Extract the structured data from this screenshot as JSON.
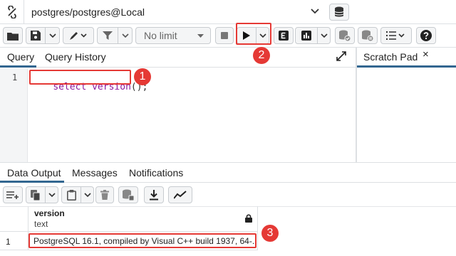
{
  "connection": {
    "label": "postgres/postgres@Local"
  },
  "toolbar": {
    "limit_label": "No limit"
  },
  "query_tabs": {
    "query": "Query",
    "history": "Query History",
    "scratch": "Scratch Pad",
    "scratch_close": "×"
  },
  "editor": {
    "line_number": "1",
    "kw_select": "select",
    "fn_version": "version",
    "parens": "()",
    "semicolon": ";"
  },
  "output_tabs": {
    "data_output": "Data Output",
    "messages": "Messages",
    "notifications": "Notifications"
  },
  "grid": {
    "column_name": "version",
    "column_type": "text",
    "rows": [
      {
        "row_number": "1",
        "value": "PostgreSQL 16.1, compiled by Visual C++ build 1937, 64-..."
      }
    ]
  },
  "markers": {
    "m1": "1",
    "m2": "2",
    "m3": "3"
  },
  "colors": {
    "accent": "#326690",
    "marker": "#e53935"
  }
}
